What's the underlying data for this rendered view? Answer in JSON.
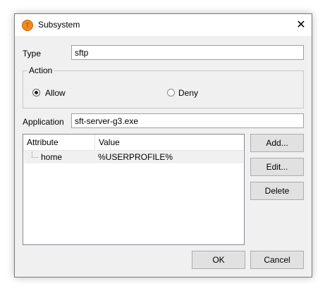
{
  "window": {
    "title": "Subsystem",
    "app_icon_letter": "T",
    "close_glyph": "✕"
  },
  "type_field": {
    "label": "Type",
    "value": "sftp"
  },
  "action_group": {
    "title": "Action",
    "options": [
      {
        "label": "Allow",
        "checked": true
      },
      {
        "label": "Deny",
        "checked": false
      }
    ]
  },
  "application_field": {
    "label": "Application",
    "value": "sft-server-g3.exe"
  },
  "attributes_table": {
    "columns": [
      "Attribute",
      "Value"
    ],
    "rows": [
      {
        "attribute": "home",
        "value": "%USERPROFILE%"
      }
    ]
  },
  "side_buttons": {
    "add": "Add...",
    "edit": "Edit...",
    "delete": "Delete"
  },
  "footer_buttons": {
    "ok": "OK",
    "cancel": "Cancel"
  },
  "icons": [
    "app-icon",
    "close-icon",
    "tree-connector-icon"
  ],
  "colors": {
    "accent": "#f08a24",
    "row_highlight": "#f0f0f0"
  }
}
